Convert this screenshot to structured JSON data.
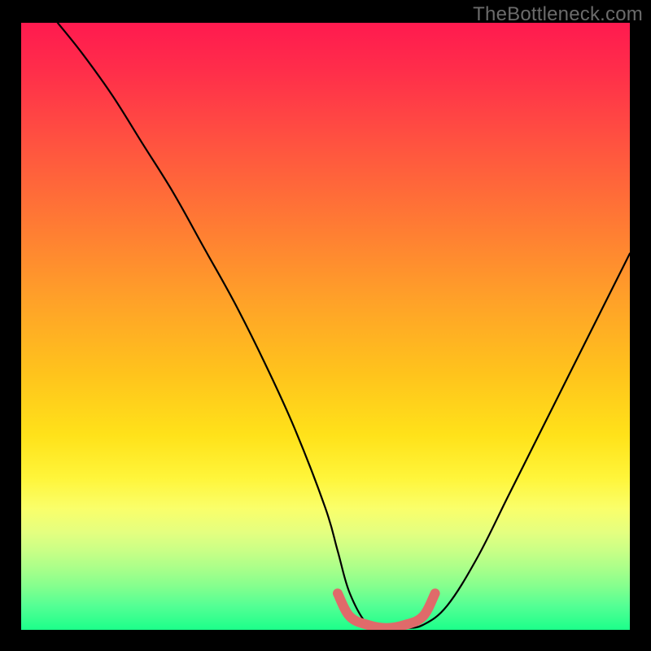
{
  "watermark": "TheBottleneck.com",
  "chart_data": {
    "type": "line",
    "title": "",
    "xlabel": "",
    "ylabel": "",
    "xlim": [
      0,
      100
    ],
    "ylim": [
      0,
      100
    ],
    "grid": false,
    "legend": false,
    "series": [
      {
        "name": "main-curve",
        "color": "#000000",
        "x": [
          6,
          10,
          15,
          20,
          25,
          30,
          35,
          40,
          45,
          50,
          52,
          54,
          57,
          60,
          63,
          66,
          70,
          75,
          80,
          85,
          90,
          95,
          100
        ],
        "values": [
          100,
          95,
          88,
          80,
          72,
          63,
          54,
          44,
          33,
          20,
          13,
          6,
          0.8,
          0.3,
          0.3,
          0.8,
          4,
          12,
          22,
          32,
          42,
          52,
          62
        ]
      },
      {
        "name": "bottom-highlight",
        "color": "#e06a6a",
        "x": [
          52,
          54,
          57,
          60,
          63,
          66,
          68
        ],
        "values": [
          6,
          2.2,
          0.8,
          0.3,
          0.8,
          2.2,
          6
        ]
      }
    ],
    "gradient_stops": [
      {
        "pos": 0,
        "color": "#ff1a4f"
      },
      {
        "pos": 20,
        "color": "#ff5340"
      },
      {
        "pos": 46,
        "color": "#ffa228"
      },
      {
        "pos": 68,
        "color": "#ffe21a"
      },
      {
        "pos": 80,
        "color": "#faff6a"
      },
      {
        "pos": 90,
        "color": "#a8ff8a"
      },
      {
        "pos": 100,
        "color": "#1cff8a"
      }
    ]
  }
}
